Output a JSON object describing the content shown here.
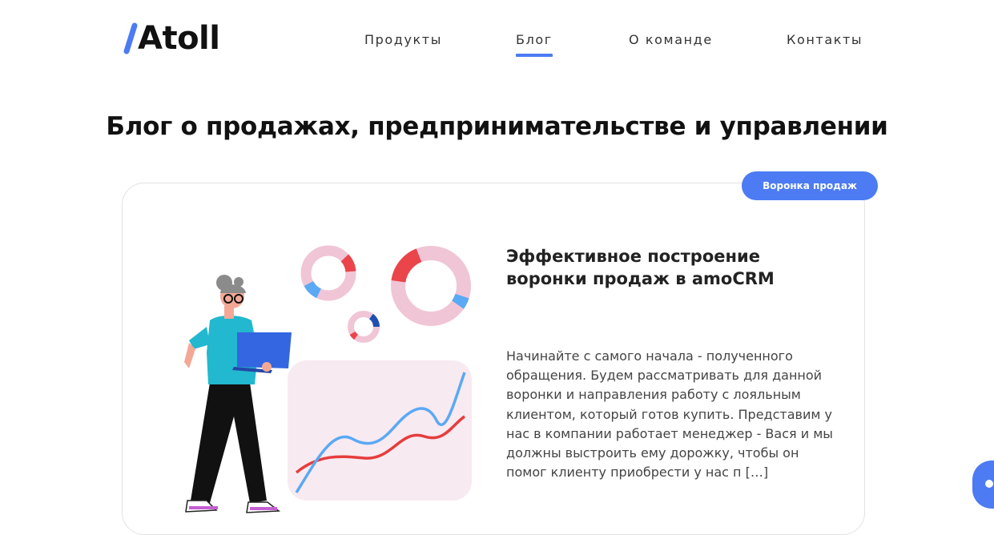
{
  "brand": {
    "logo_text": "Atoll",
    "accent_color": "#4c7bf3"
  },
  "nav": {
    "items": [
      {
        "label": "Продукты",
        "active": false
      },
      {
        "label": "Блог",
        "active": true
      },
      {
        "label": "О команде",
        "active": false
      },
      {
        "label": "Контакты",
        "active": false
      }
    ]
  },
  "page": {
    "title": "Блог о продажах, предпринимательстве и управлении"
  },
  "post": {
    "tag": "Воронка продаж",
    "title": "Эффективное построение воронки продаж в amoCRM",
    "excerpt": "Начинайте с самого начала - полученного обращения. Будем рассматривать для данной воронки и направления работу с лояльным клиентом, который готов купить. Представим у нас в компании работает менеджер - Вася и мы должны выстроить ему дорожку, чтобы он помог клиенту приобрести у нас п […]",
    "illustration": "woman-with-laptop-and-charts-illustration"
  },
  "chat_widget": {
    "icon": "chat-icon"
  }
}
